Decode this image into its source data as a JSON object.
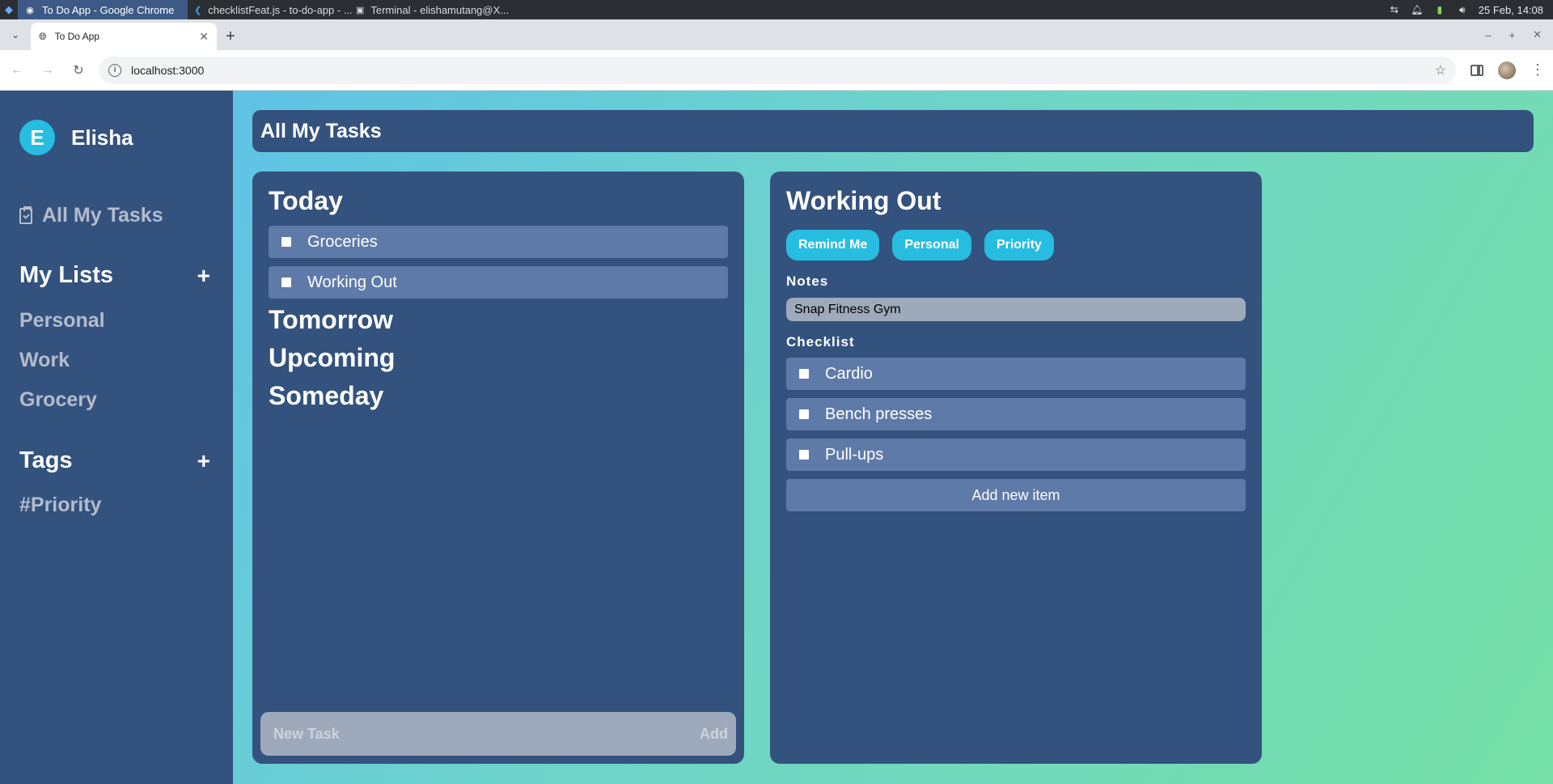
{
  "taskbar": {
    "tasks": [
      {
        "label": "To Do App - Google Chrome",
        "icon": "chrome-icon"
      },
      {
        "label": "checklistFeat.js - to-do-app - ...",
        "icon": "vscode-icon"
      },
      {
        "label": "Terminal - elishamutang@X...",
        "icon": "terminal-icon"
      }
    ],
    "datetime": "25 Feb, 14:08"
  },
  "browser": {
    "tab_title": "To Do App",
    "url": "localhost:3000"
  },
  "sidebar": {
    "avatar_initial": "E",
    "user_name": "Elisha",
    "all_tasks_label": "All My Tasks",
    "lists_heading": "My Lists",
    "lists": [
      "Personal",
      "Work",
      "Grocery"
    ],
    "tags_heading": "Tags",
    "tags": [
      "#Priority"
    ],
    "add_symbol": "+"
  },
  "header": {
    "title": "All My Tasks"
  },
  "tasks_panel": {
    "groups": {
      "today": "Today",
      "tomorrow": "Tomorrow",
      "upcoming": "Upcoming",
      "someday": "Someday"
    },
    "today_tasks": [
      "Groceries",
      "Working Out"
    ],
    "new_task_placeholder": "New Task",
    "add_label": "Add"
  },
  "detail_panel": {
    "title": "Working Out",
    "buttons": [
      "Remind Me",
      "Personal",
      "Priority"
    ],
    "notes_label": "Notes",
    "notes_value": "Snap Fitness Gym",
    "checklist_label": "Checklist",
    "checklist": [
      "Cardio",
      "Bench presses",
      "Pull-ups"
    ],
    "add_item_label": "Add new item"
  },
  "colors": {
    "panel": "#34527e",
    "row": "#5e7aa8",
    "accent": "#26bde0",
    "input": "#9eaabb"
  }
}
